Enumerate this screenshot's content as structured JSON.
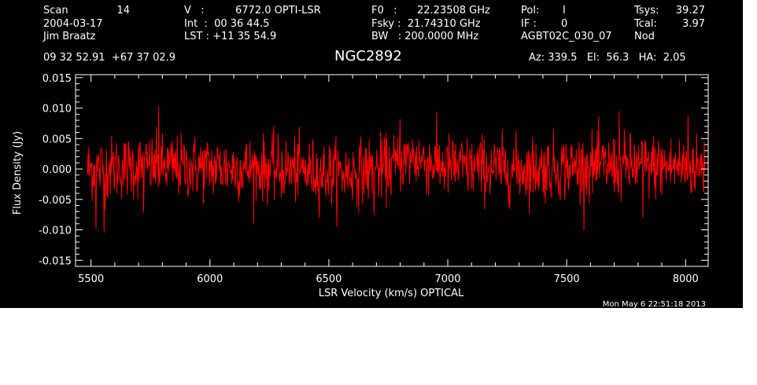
{
  "header": {
    "col1": {
      "scan_label": "Scan",
      "scan_value": "14",
      "date": "2004-03-17",
      "observer": "Jim Braatz"
    },
    "col2": {
      "v_label": "V   :",
      "v_value": "6772.0 OPTI-LSR",
      "int_line": "Int  :  00 36 44.5",
      "lst_line": "LST : +11 35 54.9"
    },
    "col3": {
      "f0_label": "F0   :",
      "f0_value": "22.23508 GHz",
      "fsky_line": "Fsky :  21.74310 GHz",
      "bw_line": "BW   : 200.0000 MHz"
    },
    "col4": {
      "pol_label": "Pol:",
      "pol_value": "I",
      "if_label": "IF :",
      "if_value": "0",
      "project": "AGBT02C_030_07"
    },
    "col5": {
      "tsys_label": "Tsys:",
      "tsys_value": "39.27",
      "tcal_label": "Tcal:",
      "tcal_value": "3.97",
      "proc": "Nod"
    },
    "coords": "09 32 52.91  +67 37 02.9",
    "source": "NGC2892",
    "az_el_ha": "Az: 339.5   El:  56.3   HA:  2.05",
    "timestamp": "Mon May  6 22:51:18 2013"
  },
  "colors": {
    "background": "#000000",
    "foreground": "#ffffff",
    "series": "#ff0000"
  },
  "chart_data": {
    "type": "line",
    "xlabel": "LSR Velocity (km/s) OPTICAL",
    "ylabel": "Flux Density (Jy)",
    "xlim": [
      5435,
      8095
    ],
    "ylim": [
      -0.016,
      0.0155
    ],
    "x_ticks": [
      5500,
      6000,
      6500,
      7000,
      7500,
      8000
    ],
    "x_tick_labels": [
      "5500",
      "6000",
      "6500",
      "7000",
      "7500",
      "8000"
    ],
    "y_ticks": [
      -0.015,
      -0.01,
      -0.005,
      0.0,
      0.005,
      0.01,
      0.015
    ],
    "y_tick_labels": [
      "-0.015",
      "-0.010",
      "-0.005",
      "0.000",
      "0.005",
      "0.010",
      "0.015"
    ],
    "grid": false,
    "series": [
      {
        "noise_rms": 0.0026,
        "x_start": 5485,
        "x_end": 8080,
        "n_channels": 1300,
        "baseline": [
          [
            5485,
            0.0
          ],
          [
            5700,
            0.0004
          ],
          [
            6000,
            0.0003
          ],
          [
            6300,
            0.0
          ],
          [
            6550,
            -0.0008
          ],
          [
            6750,
            0.0002
          ],
          [
            6850,
            0.0018
          ],
          [
            7000,
            0.0004
          ],
          [
            7300,
            0.0
          ],
          [
            7700,
            0.0005
          ],
          [
            8080,
            0.0004
          ]
        ],
        "features": [
          {
            "x": 5555,
            "y": -0.0105
          },
          {
            "x": 5520,
            "y": -0.0098
          },
          {
            "x": 5785,
            "y": 0.0103
          },
          {
            "x": 5720,
            "y": -0.0072
          },
          {
            "x": 6690,
            "y": -0.0075
          },
          {
            "x": 6800,
            "y": 0.0082
          },
          {
            "x": 7720,
            "y": 0.0095
          },
          {
            "x": 7820,
            "y": -0.008
          },
          {
            "x": 8010,
            "y": 0.0088
          }
        ]
      }
    ]
  }
}
